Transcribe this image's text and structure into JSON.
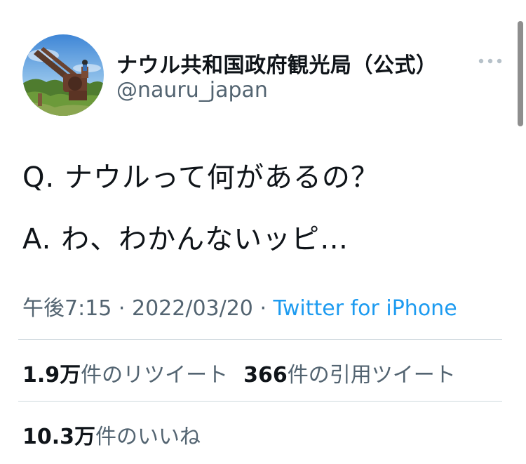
{
  "header": {
    "display_name": "ナウル共和国政府観光局（公式）",
    "handle": "@nauru_japan",
    "more_icon": "more-horizontal-icon"
  },
  "tweet": {
    "lines": [
      "Q. ナウルって何があるの？",
      "A. わ、わかんないッピ…"
    ]
  },
  "meta": {
    "time": "午後7:15",
    "separator": " · ",
    "date": "2022/03/20",
    "source": "Twitter for iPhone"
  },
  "stats": {
    "retweets": {
      "count": "1.9万",
      "label": "件のリツイート"
    },
    "quotes": {
      "count": "366",
      "label": "件の引用ツイート"
    },
    "likes": {
      "count": "10.3万",
      "label": "件のいいね"
    }
  },
  "colors": {
    "text": "#0f1419",
    "secondary": "#536471",
    "link": "#1d9bf0",
    "divider": "#cfd9de"
  }
}
